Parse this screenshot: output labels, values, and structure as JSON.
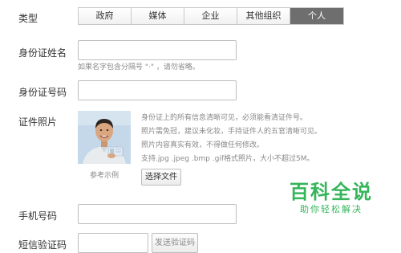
{
  "type_field": {
    "label": "类型",
    "options": [
      "政府",
      "媒体",
      "企业",
      "其他组织",
      "个人"
    ],
    "selected": "个人"
  },
  "name_field": {
    "label": "身份证姓名",
    "value": "",
    "hint": "如果名字包含分隔号 \"·\" ，请勿省略。"
  },
  "id_field": {
    "label": "身份证号码",
    "value": ""
  },
  "photo_field": {
    "label": "证件照片",
    "example_caption": "参考示例",
    "instructions": [
      "身份证上的所有信息清晰可见，必须能看清证件号。",
      "照片需免冠，建议未化妆，手持证件人的五官清晰可见。",
      "照片内容真实有效，不得做任何修改。",
      "支持.jpg .jpeg .bmp .gif格式照片，大小不超过5M。"
    ],
    "upload_button": "选择文件"
  },
  "phone_field": {
    "label": "手机号码",
    "value": ""
  },
  "sms_field": {
    "label": "短信验证码",
    "value": "",
    "send_button": "发送验证码"
  },
  "watermark": {
    "main": "百科全说",
    "sub": "助你轻松解决"
  },
  "colors": {
    "active_tab": "#6e6e6e",
    "watermark_green": "#35b55a"
  }
}
